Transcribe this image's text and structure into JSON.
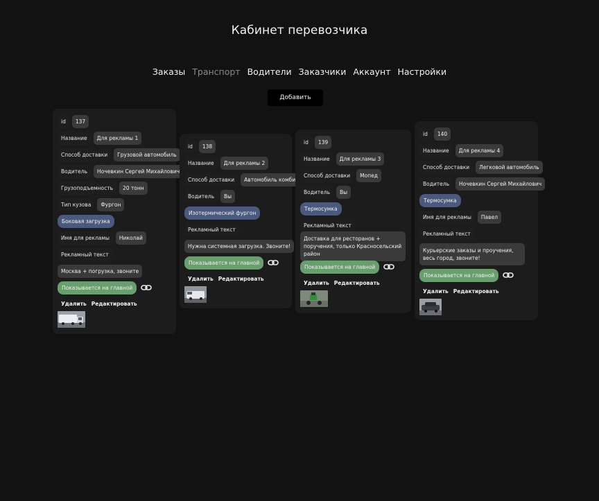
{
  "header": {
    "title": "Кабинет перевозчика"
  },
  "nav": {
    "items": [
      {
        "label": "Заказы"
      },
      {
        "label": "Транспорт"
      },
      {
        "label": "Водители"
      },
      {
        "label": "Заказчики"
      },
      {
        "label": "Аккаунт"
      },
      {
        "label": "Настройки"
      }
    ],
    "active": "Транспорт"
  },
  "toolbar": {
    "add_label": "Добавить"
  },
  "colors": {
    "background": "#121212",
    "card": "#1c1c1c",
    "value_chip": "#3a3a3a",
    "type_tag": "#4b5a7c",
    "main_page_tag": "#6a9e6e"
  },
  "cards": [
    {
      "id_label": "id",
      "id": "137",
      "name_label": "Название",
      "name": "Для рекламы 1",
      "delivery_label": "Способ доставки",
      "delivery": "Грузовой автомобиль",
      "driver_label": "Водитель",
      "driver": "Ночевкин Сергей Михайлович",
      "capacity_label": "Грузоподъемность",
      "capacity": "20 тонн",
      "body_label": "Тип кузова",
      "body": "Фургон",
      "tag": "Боковая загрузка",
      "ad_name_label": "Имя для рекламы",
      "ad_name": "Николай",
      "ad_text_label": "Рекламный текст",
      "ad_text": "Москва + погрузка, звоните",
      "main_page": "Показывается на главной",
      "delete_label": "Удалить",
      "edit_label": "Редактировать",
      "thumb_icon": "truck-photo"
    },
    {
      "id_label": "id",
      "id": "138",
      "name_label": "Название",
      "name": "Для рекламы 2",
      "delivery_label": "Способ доставки",
      "delivery": "Автомобиль комби",
      "driver_label": "Водитель",
      "driver": "Вы",
      "tag": "Изотермический фургон",
      "ad_text_label": "Рекламный текст",
      "ad_text": "Нужна системная загрузка. Звоните!",
      "main_page": "Показывается на главной",
      "delete_label": "Удалить",
      "edit_label": "Редактировать",
      "thumb_icon": "van-photo"
    },
    {
      "id_label": "id",
      "id": "139",
      "name_label": "Название",
      "name": "Для рекламы 3",
      "delivery_label": "Способ доставки",
      "delivery": "Мопед",
      "driver_label": "Водитель",
      "driver": "Вы",
      "tag": "Термосумка",
      "ad_text_label": "Рекламный текст",
      "ad_text": "Доставка для ресторанов + поручения, только Красносельский район",
      "main_page": "Показывается на главной",
      "delete_label": "Удалить",
      "edit_label": "Редактировать",
      "thumb_icon": "moped-photo"
    },
    {
      "id_label": "id",
      "id": "140",
      "name_label": "Название",
      "name": "Для рекламы 4",
      "delivery_label": "Способ доставки",
      "delivery": "Легковой автомобиль",
      "driver_label": "Водитель",
      "driver": "Ночевкин Сергей Михайлович",
      "tag": "Термосумка",
      "ad_name_label": "Имя для рекламы",
      "ad_name": "Павел",
      "ad_text_label": "Рекламный текст",
      "ad_text": "Курьерские заказы и проучения, весь город, звоните!",
      "main_page": "Показывается на главной",
      "delete_label": "Удалить",
      "edit_label": "Редактировать",
      "thumb_icon": "car-photo"
    }
  ]
}
